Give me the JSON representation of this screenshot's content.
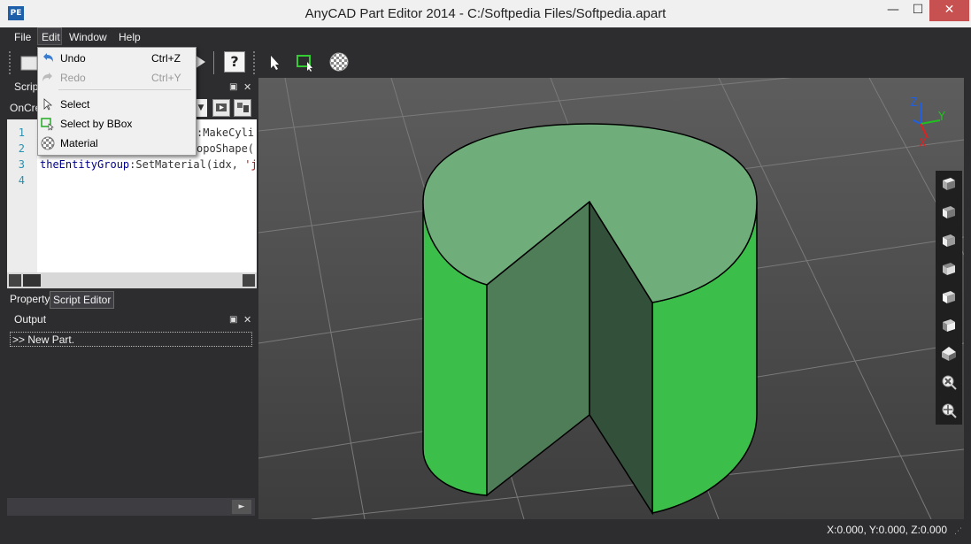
{
  "window": {
    "title": "AnyCAD Part Editor 2014 - C:/Softpedia Files/Softpedia.apart",
    "app_icon": "PE",
    "minimize": "—",
    "maximize": "☐",
    "close": "✕"
  },
  "menubar": {
    "file": "File",
    "edit": "Edit",
    "window": "Window",
    "help": "Help"
  },
  "edit_menu": {
    "items": [
      {
        "label": "Undo",
        "shortcut": "Ctrl+Z",
        "enabled": true,
        "icon": "undo-icon"
      },
      {
        "label": "Redo",
        "shortcut": "Ctrl+Y",
        "enabled": false,
        "icon": "redo-icon"
      },
      {
        "label": "Select",
        "shortcut": "",
        "enabled": true,
        "icon": "cursor-icon"
      },
      {
        "label": "Select by BBox",
        "shortcut": "",
        "enabled": true,
        "icon": "bbox-select-icon"
      },
      {
        "label": "Material",
        "shortcut": "",
        "enabled": true,
        "icon": "material-icon"
      }
    ]
  },
  "toolbar": {
    "help_label": "?"
  },
  "script_panel": {
    "title": "Script",
    "function_name": "OnCre",
    "lines": [
      {
        "num": "1",
        "text": ":MakeCylir"
      },
      {
        "num": "2",
        "text": "opoShape("
      },
      {
        "num": "3",
        "text_obj": "theEntityGroup",
        "text_rest": ":SetMaterial(idx, ",
        "text_str": "'jade"
      },
      {
        "num": "4",
        "text": ""
      }
    ]
  },
  "panel_tabs": {
    "property": "Property",
    "script_editor": "Script Editor"
  },
  "output_panel": {
    "title": "Output",
    "line": ">> New Part."
  },
  "status": {
    "coords": "X:0.000, Y:0.000, Z:0.000"
  },
  "axes": {
    "x": "X",
    "y": "Y",
    "z": "Z"
  },
  "colors": {
    "cylinder_side": "#3cbf4a",
    "cylinder_top": "#6fae7a",
    "cut_face_left": "#4f7d58",
    "cut_face_right": "#33503a",
    "axis_x": "#e02020",
    "axis_y": "#20c020",
    "axis_z": "#2060e0"
  }
}
